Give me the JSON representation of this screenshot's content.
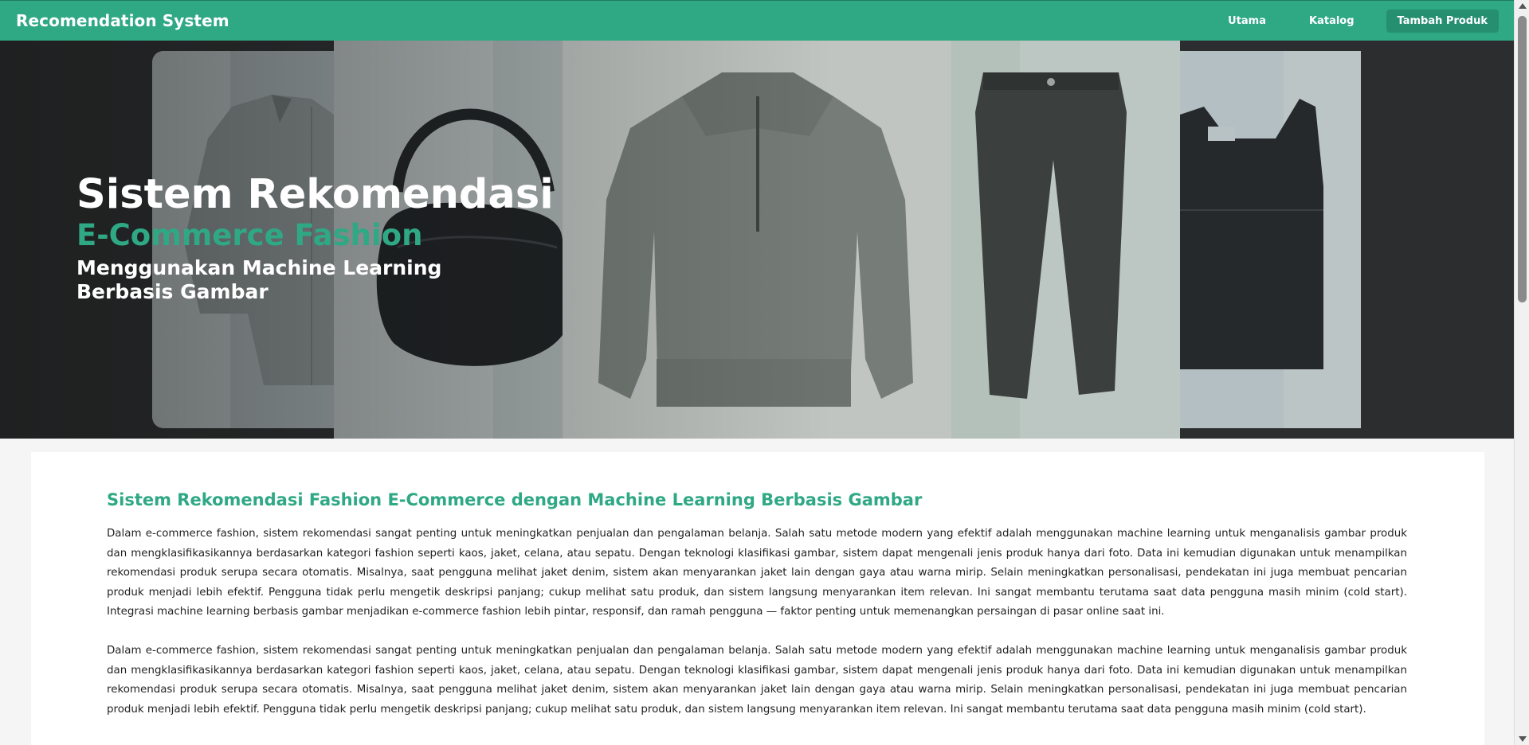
{
  "navbar": {
    "brand": "Recomendation System",
    "links": [
      {
        "label": "Utama"
      },
      {
        "label": "Katalog"
      },
      {
        "label": "Tambah Produk"
      }
    ]
  },
  "hero": {
    "title": "Sistem Rekomendasi",
    "subtitle": "E-Commerce Fashion",
    "tagline": "Menggunakan Machine Learning Berbasis Gambar",
    "images": [
      "shirt-image",
      "handbag-image",
      "sweater-image",
      "jeans-image",
      "leather-top-image"
    ]
  },
  "content": {
    "title": "Sistem Rekomendasi Fashion E-Commerce dengan Machine Learning Berbasis Gambar",
    "paragraph1": "Dalam e-commerce fashion, sistem rekomendasi sangat penting untuk meningkatkan penjualan dan pengalaman belanja. Salah satu metode modern yang efektif adalah menggunakan machine learning untuk menganalisis gambar produk dan mengklasifikasikannya berdasarkan kategori fashion seperti kaos, jaket, celana, atau sepatu. Dengan teknologi klasifikasi gambar, sistem dapat mengenali jenis produk hanya dari foto. Data ini kemudian digunakan untuk menampilkan rekomendasi produk serupa secara otomatis. Misalnya, saat pengguna melihat jaket denim, sistem akan menyarankan jaket lain dengan gaya atau warna mirip. Selain meningkatkan personalisasi, pendekatan ini juga membuat pencarian produk menjadi lebih efektif. Pengguna tidak perlu mengetik deskripsi panjang; cukup melihat satu produk, dan sistem langsung menyarankan item relevan. Ini sangat membantu terutama saat data pengguna masih minim (cold start). Integrasi machine learning berbasis gambar menjadikan e-commerce fashion lebih pintar, responsif, dan ramah pengguna — faktor penting untuk memenangkan persaingan di pasar online saat ini.",
    "paragraph2": "Dalam e-commerce fashion, sistem rekomendasi sangat penting untuk meningkatkan penjualan dan pengalaman belanja. Salah satu metode modern yang efektif adalah menggunakan machine learning untuk menganalisis gambar produk dan mengklasifikasikannya berdasarkan kategori fashion seperti kaos, jaket, celana, atau sepatu. Dengan teknologi klasifikasi gambar, sistem dapat mengenali jenis produk hanya dari foto. Data ini kemudian digunakan untuk menampilkan rekomendasi produk serupa secara otomatis. Misalnya, saat pengguna melihat jaket denim, sistem akan menyarankan jaket lain dengan gaya atau warna mirip. Selain meningkatkan personalisasi, pendekatan ini juga membuat pencarian produk menjadi lebih efektif. Pengguna tidak perlu mengetik deskripsi panjang; cukup melihat satu produk, dan sistem langsung menyarankan item relevan. Ini sangat membantu terutama saat data pengguna masih minim (cold start)."
  },
  "colors": {
    "accent": "#2fa884",
    "navbar": "#2fa884",
    "hero_bg": "#2b2d2e"
  }
}
